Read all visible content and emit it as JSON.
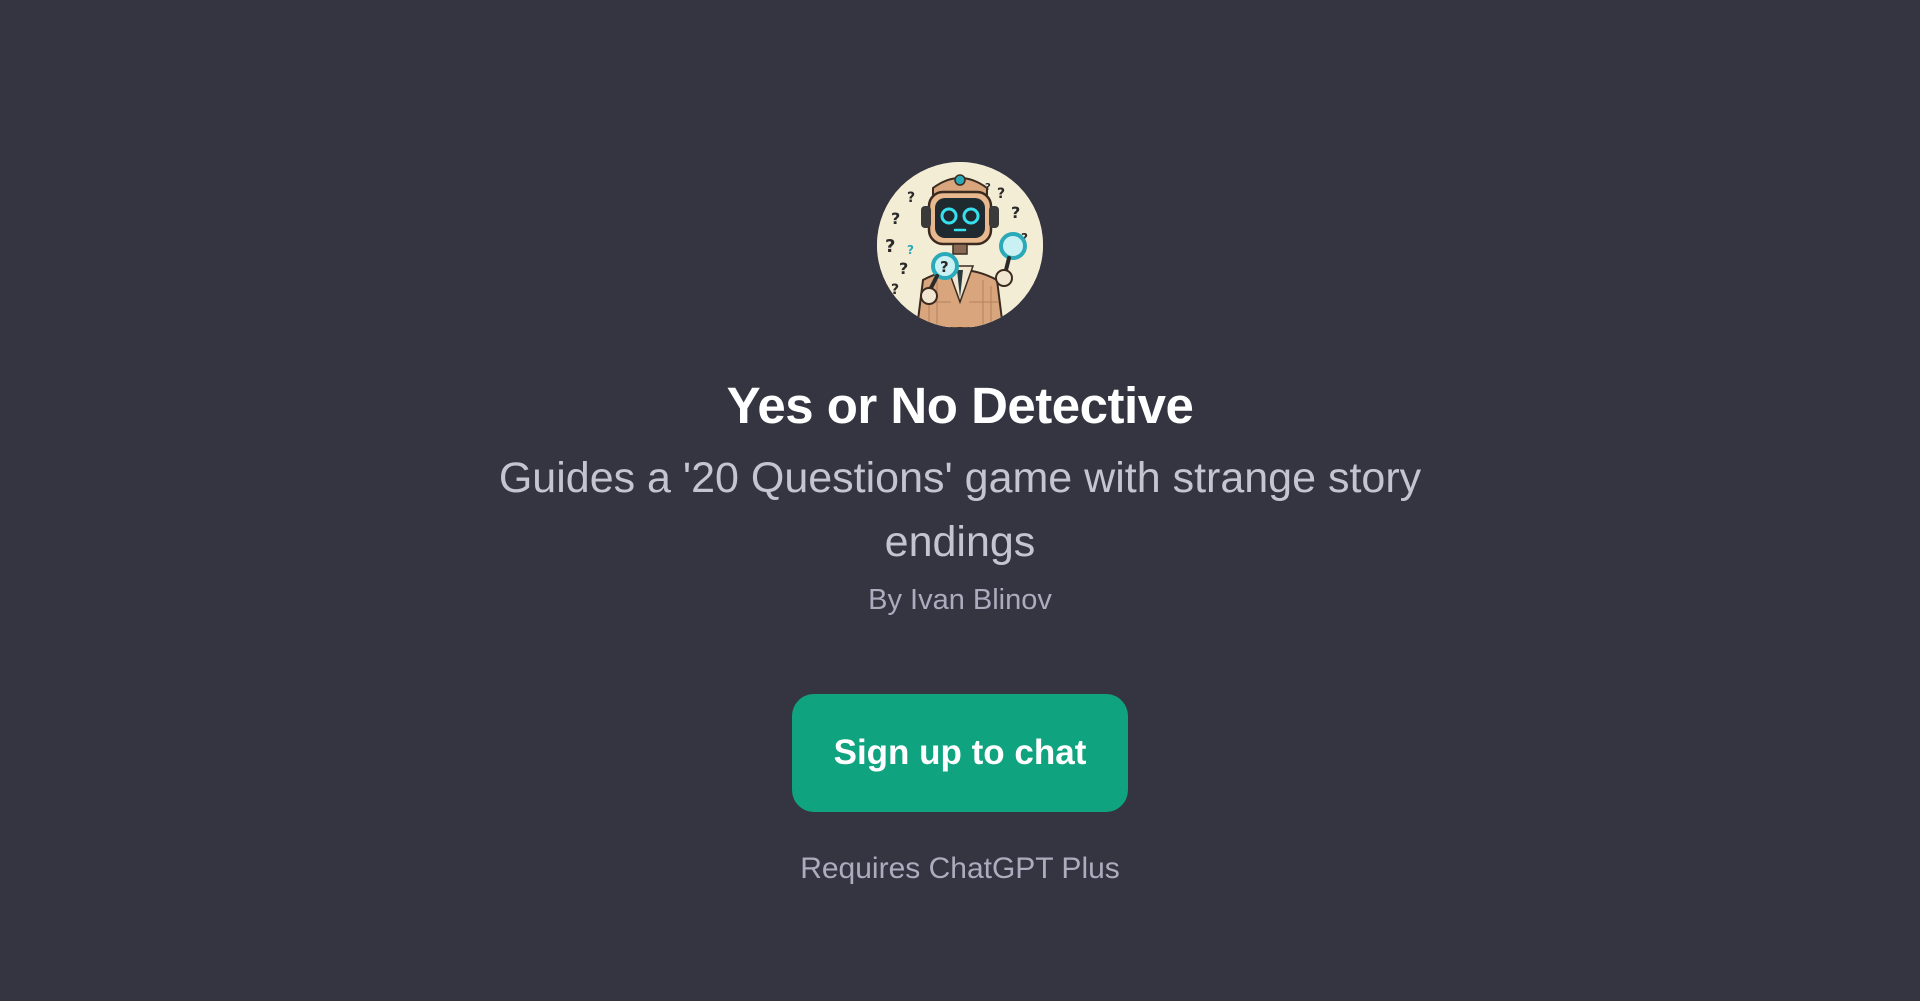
{
  "gpt": {
    "avatar_icon": "detective-robot-avatar",
    "title": "Yes or No Detective",
    "description": "Guides a '20 Questions' game with strange story endings",
    "author": "By Ivan Blinov"
  },
  "cta": {
    "signup_label": "Sign up to chat",
    "requirement": "Requires ChatGPT Plus"
  },
  "colors": {
    "background": "#343541",
    "button": "#10a37f",
    "title": "#ffffff",
    "description": "#c5c5d2",
    "muted": "#acacbe"
  }
}
